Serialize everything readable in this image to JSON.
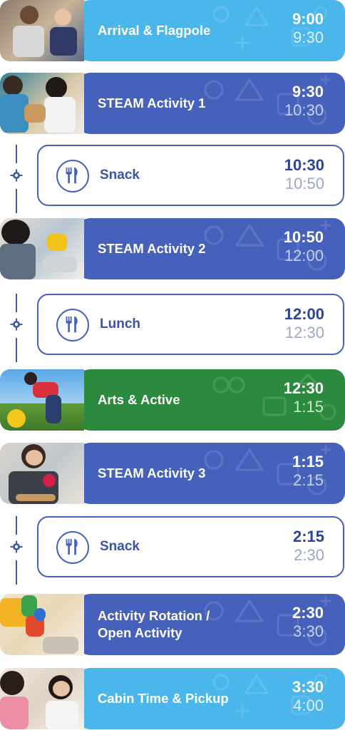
{
  "schedule": [
    {
      "kind": "activity",
      "title": "Arrival & Flagpole",
      "start": "9:00",
      "end": "9:30",
      "color": "#4ab6ea"
    },
    {
      "kind": "activity",
      "title": "STEAM Activity 1",
      "start": "9:30",
      "end": "10:30",
      "color": "#4661bb"
    },
    {
      "kind": "meal",
      "title": "Snack",
      "start": "10:30",
      "end": "10:50"
    },
    {
      "kind": "activity",
      "title": "STEAM Activity 2",
      "start": "10:50",
      "end": "12:00",
      "color": "#4661bb"
    },
    {
      "kind": "meal",
      "title": "Lunch",
      "start": "12:00",
      "end": "12:30"
    },
    {
      "kind": "activity",
      "title": "Arts & Active",
      "start": "12:30",
      "end": "1:15",
      "color": "#2c8a3e"
    },
    {
      "kind": "activity",
      "title": "STEAM Activity 3",
      "start": "1:15",
      "end": "2:15",
      "color": "#4661bb"
    },
    {
      "kind": "meal",
      "title": "Snack",
      "start": "2:15",
      "end": "2:30"
    },
    {
      "kind": "activity",
      "title": "Activity Rotation /\nOpen Activity",
      "start": "2:30",
      "end": "3:30",
      "color": "#4661bb"
    },
    {
      "kind": "activity",
      "title": "Cabin Time & Pickup",
      "start": "3:30",
      "end": "4:00",
      "color": "#4ab6ea"
    }
  ],
  "icons": {
    "meal": "fork-knife-icon",
    "rail": "gear-icon",
    "photo": "camp-photo"
  },
  "colors": {
    "primary": "#4661bb",
    "sky": "#4ab6ea",
    "green": "#2c8a3e"
  }
}
